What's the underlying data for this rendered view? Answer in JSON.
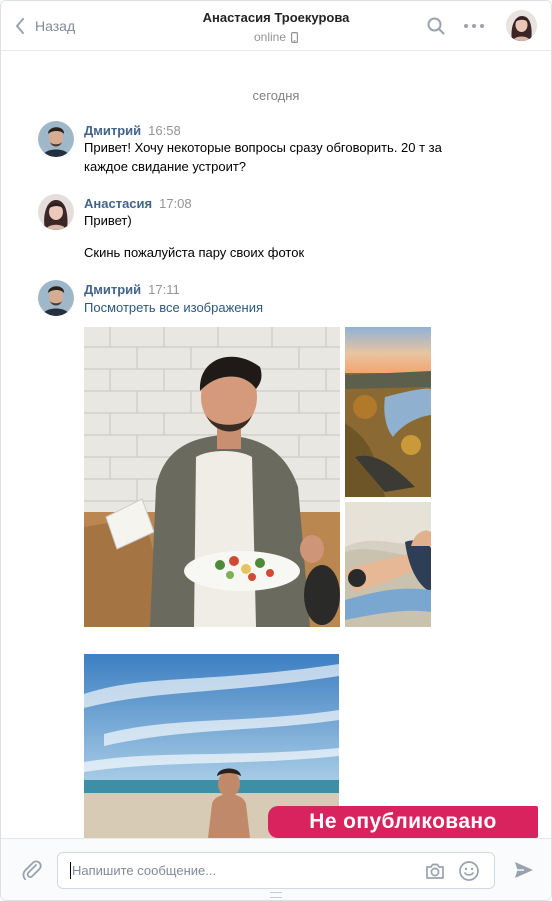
{
  "header": {
    "back_label": "Назад",
    "contact_name": "Анастасия Троекурова",
    "status": "online"
  },
  "chat": {
    "date_divider": "сегодня",
    "messages": [
      {
        "author": "Дмитрий",
        "time": "16:58",
        "text": "Привет! Хочу некоторые вопросы сразу обговорить. 20 т за каждое свидание устроит?"
      },
      {
        "author": "Анастасия",
        "time": "17:08",
        "text": "Привет)",
        "text2": "Скинь пожалуйста пару своих фоток"
      },
      {
        "author": "Дмитрий",
        "time": "17:11",
        "link": "Посмотреть все изображения",
        "photos": [
          "photo-man-with-salad",
          "photo-river-sunset",
          "photo-legs-on-hill",
          "photo-beach"
        ]
      }
    ]
  },
  "badge": "Не опубликовано",
  "composer": {
    "placeholder": "Напишите сообщение..."
  },
  "colors": {
    "author": "#42648b",
    "link": "#2a5885",
    "badge": "#d9235f",
    "muted": "#828a99"
  },
  "icons": [
    "chevron-left-icon",
    "search-icon",
    "more-icon",
    "phone-icon",
    "paperclip-icon",
    "camera-icon",
    "smile-icon",
    "send-icon"
  ]
}
